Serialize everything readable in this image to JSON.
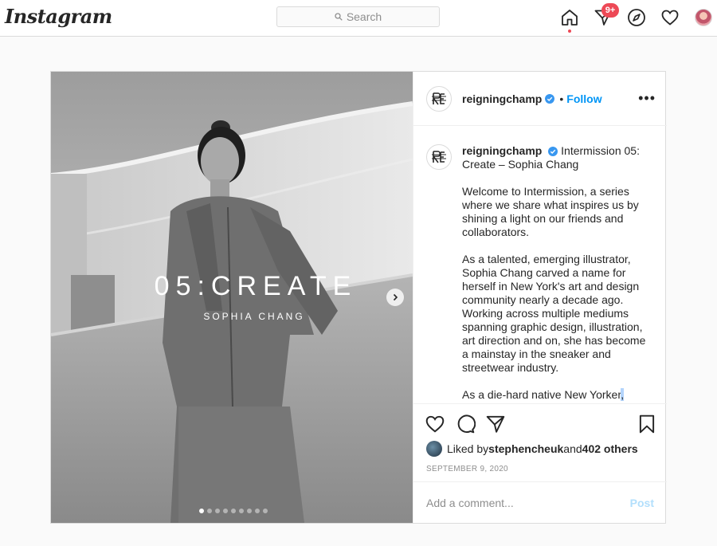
{
  "nav": {
    "logo": "Instagram",
    "search_placeholder": "Search",
    "notification_badge": "9+",
    "icons": [
      "home-icon",
      "direct-icon",
      "explore-icon",
      "activity-icon",
      "profile-avatar"
    ]
  },
  "post": {
    "username": "reigningchamp",
    "verified": true,
    "separator": "•",
    "follow_label": "Follow",
    "more_label": "•••",
    "avatar_monogram": "RC",
    "media": {
      "title": "05:CREATE",
      "subtitle": "SOPHIA CHANG",
      "carousel_count": 9,
      "carousel_active": 0
    },
    "caption": {
      "first": "Intermission 05: Create – Sophia Chang",
      "paragraphs": [
        "Welcome to Intermission, a series where we share what inspires us by shining a light on our friends and collaborators.",
        "As a talented, emerging illustrator, Sophia Chang carved a name for herself in New York's art and design community nearly a decade ago. Working across multiple mediums spanning graphic design, illustration, art direction and on, she has become a mainstay in the sneaker and streetwear industry."
      ],
      "last": "As a die-hard native New Yorker",
      "last_highlight": ","
    },
    "likes": {
      "prefix": "Liked by ",
      "user": "stephencheuk",
      "middle": " and ",
      "others": "402 others"
    },
    "date": "SEPTEMBER 9, 2020",
    "comment_placeholder": "Add a comment...",
    "post_button": "Post"
  },
  "colors": {
    "accent": "#0095f6",
    "badge": "#ed4956",
    "post_disabled": "#b2dffc"
  }
}
